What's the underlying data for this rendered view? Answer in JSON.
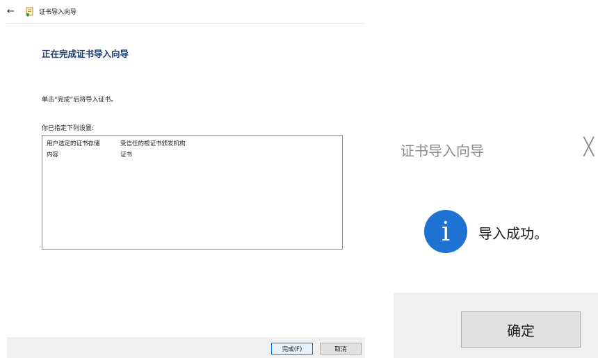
{
  "wizard": {
    "title": "证书导入向导",
    "heading": "正在完成证书导入向导",
    "instruction": "单击“完成”后将导入证书。",
    "settings_label": "你已指定下列设置:",
    "settings": [
      {
        "key": "用户选定的证书存储",
        "value": "受信任的根证书颁发机构"
      },
      {
        "key": "内容",
        "value": "证书"
      }
    ],
    "finish_label": "完成(F)",
    "cancel_label": "取消"
  },
  "message_box": {
    "title": "证书导入向导",
    "close_glyph": "╳",
    "message": "导入成功。",
    "ok_label": "确定",
    "icon": "info-icon",
    "icon_glyph": "i",
    "icon_color": "#1e73d2"
  }
}
